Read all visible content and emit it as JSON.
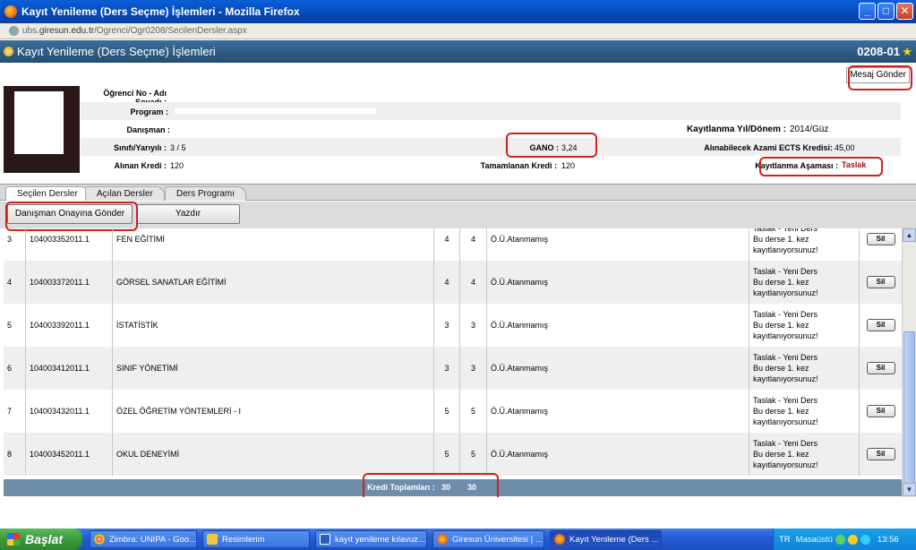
{
  "window": {
    "title": "Kayıt Yenileme (Ders Seçme) İşlemleri - Mozilla Firefox"
  },
  "urlbar": {
    "prefix": "ubs.",
    "domain": "giresun.edu.tr",
    "path": "/Ogrenci/Ogr0208/SecilenDersler.aspx"
  },
  "header": {
    "title": "Kayıt Yenileme (Ders Seçme) İşlemleri",
    "code": "0208-01"
  },
  "message_button": "Mesaj Gönder",
  "info": {
    "student_label": "Öğrenci No - Adı Soyadı :",
    "program_label": "Program :",
    "advisor_label": "Danışman :",
    "term_label": "Kayıtlanma Yıl/Dönem :",
    "term_value": "2014/Güz",
    "class_label": "Sınıfı/Yarıyılı :",
    "class_value": "3 / 5",
    "gano_label": "GANO :",
    "gano_value": "3,24",
    "ects_label": "Alınabilecek Azami ECTS Kredisi:",
    "ects_value": "45,00",
    "credit_label": "Alınan Kredi :",
    "credit_value": "120",
    "completed_label": "Tamamlanan Kredi :",
    "completed_value": "120",
    "stage_label": "Kayıtlanma Aşaması :",
    "stage_value": "Taslak"
  },
  "tabs": [
    "Seçilen Dersler",
    "Açılan Dersler",
    "Ders Programı"
  ],
  "buttons": {
    "advisor_approval": "Danışman Onayına Gönder",
    "print": "Yazdır"
  },
  "rows": [
    {
      "no": "3",
      "code": "104003352011.1",
      "name": "FEN EĞİTİMİ",
      "t": "4",
      "k": "4",
      "lecturer": "Ö.Ü.Atanmamış",
      "d1": "Taslak - Yeni Ders",
      "d2": "Bu derse 1. kez",
      "d3": "kayıtlanıyorsunuz!",
      "action": "Sil"
    },
    {
      "no": "4",
      "code": "104003372011.1",
      "name": "GÖRSEL SANATLAR EĞİTİMİ",
      "t": "4",
      "k": "4",
      "lecturer": "Ö.Ü.Atanmamış",
      "d1": "Taslak - Yeni Ders",
      "d2": "Bu derse 1. kez",
      "d3": "kayıtlanıyorsunuz!",
      "action": "Sil"
    },
    {
      "no": "5",
      "code": "104003392011.1",
      "name": "İSTATİSTİK",
      "t": "3",
      "k": "3",
      "lecturer": "Ö.Ü.Atanmamış",
      "d1": "Taslak - Yeni Ders",
      "d2": "Bu derse 1. kez",
      "d3": "kayıtlanıyorsunuz!",
      "action": "Sil"
    },
    {
      "no": "6",
      "code": "104003412011.1",
      "name": "SINIF YÖNETİMİ",
      "t": "3",
      "k": "3",
      "lecturer": "Ö.Ü.Atanmamış",
      "d1": "Taslak - Yeni Ders",
      "d2": "Bu derse 1. kez",
      "d3": "kayıtlanıyorsunuz!",
      "action": "Sil"
    },
    {
      "no": "7",
      "code": "104003432011.1",
      "name": "ÖZEL ÖĞRETİM YÖNTEMLERİ - I",
      "t": "5",
      "k": "5",
      "lecturer": "Ö.Ü.Atanmamış",
      "d1": "Taslak - Yeni Ders",
      "d2": "Bu derse 1. kez",
      "d3": "kayıtlanıyorsunuz!",
      "action": "Sil"
    },
    {
      "no": "8",
      "code": "104003452011.1",
      "name": "OKUL DENEYİMİ",
      "t": "5",
      "k": "5",
      "lecturer": "Ö.Ü.Atanmamış",
      "d1": "Taslak - Yeni Ders",
      "d2": "Bu derse 1. kez",
      "d3": "kayıtlanıyorsunuz!",
      "action": "Sil"
    }
  ],
  "totals": {
    "label": "Kredi Toplamları :",
    "t": "30",
    "k": "30"
  },
  "taskbar": {
    "start": "Başlat",
    "tasks": [
      "Zimbra: UNIPA - Goo...",
      "Resimlerim",
      "kayıt yenileme kılavuz...",
      "Giresun Üniversitesi | ...",
      "Kayıt Yenileme (Ders ..."
    ],
    "lang": "TR",
    "desktop": "Masaüstü",
    "clock": "13:56"
  }
}
